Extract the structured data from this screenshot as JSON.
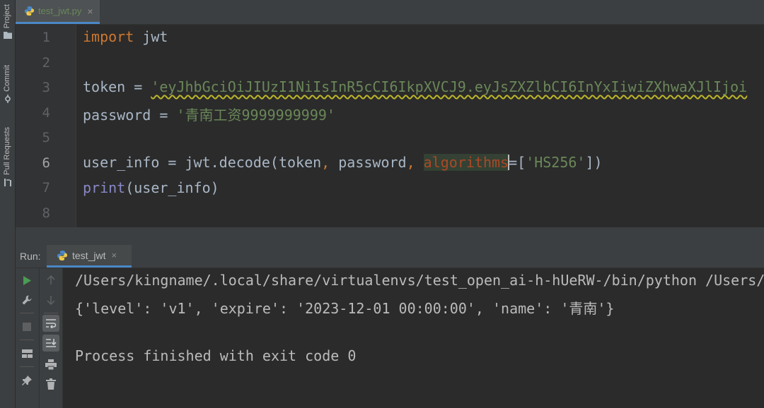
{
  "tool_strip": {
    "project_label": "Project",
    "commit_label": "Commit",
    "pull_requests_label": "Pull Requests"
  },
  "editor_tab": {
    "label": "test_jwt.py",
    "close": "×"
  },
  "line_numbers": [
    "1",
    "2",
    "3",
    "4",
    "5",
    "6",
    "7",
    "8"
  ],
  "code": {
    "l1_kw": "import",
    "l1_rest": " jwt",
    "l3_var": "token = ",
    "l3_str": "'eyJhbGciOiJIUzI1NiIsInR5cCI6IkpXVCJ9.eyJsZXZlbCI6InYxIiwiZXhwaXJlIjoi",
    "l4_var": "password = ",
    "l4_str": "'青南工资9999999999'",
    "l6_a": "user_info = jwt.decode(token",
    "l6_comma1": ",",
    "l6_b": " password",
    "l6_comma2": ",",
    "l6_param": "algorithms",
    "l6_eq": "=[",
    "l6_str": "'HS256'",
    "l6_end": "])",
    "l7_builtin": "print",
    "l7_rest": "(user_info)"
  },
  "run_panel": {
    "title": "Run:",
    "tab_label": "test_jwt",
    "tab_close": "×"
  },
  "console": {
    "line1": "/Users/kingname/.local/share/virtualenvs/test_open_ai-h-hUeRW-/bin/python /Users/",
    "line2": "{'level': 'v1', 'expire': '2023-12-01 00:00:00', 'name': '青南'}",
    "line4": "Process finished with exit code 0"
  },
  "icons": {
    "run": "play-icon",
    "wrench": "wrench-icon",
    "stop": "stop-icon",
    "layout": "layout-icon",
    "pin": "pin-icon",
    "up": "arrow-up-icon",
    "down": "arrow-down-icon",
    "soft_wrap": "soft-wrap-icon",
    "scroll_end": "scroll-to-end-icon",
    "print": "print-icon",
    "trash": "trash-icon"
  },
  "colors": {
    "keyword": "#cc7832",
    "string": "#6a8759",
    "builtin": "#8888c6",
    "param": "#aa4926",
    "run_green": "#499c54",
    "accent": "#4a88c7"
  }
}
